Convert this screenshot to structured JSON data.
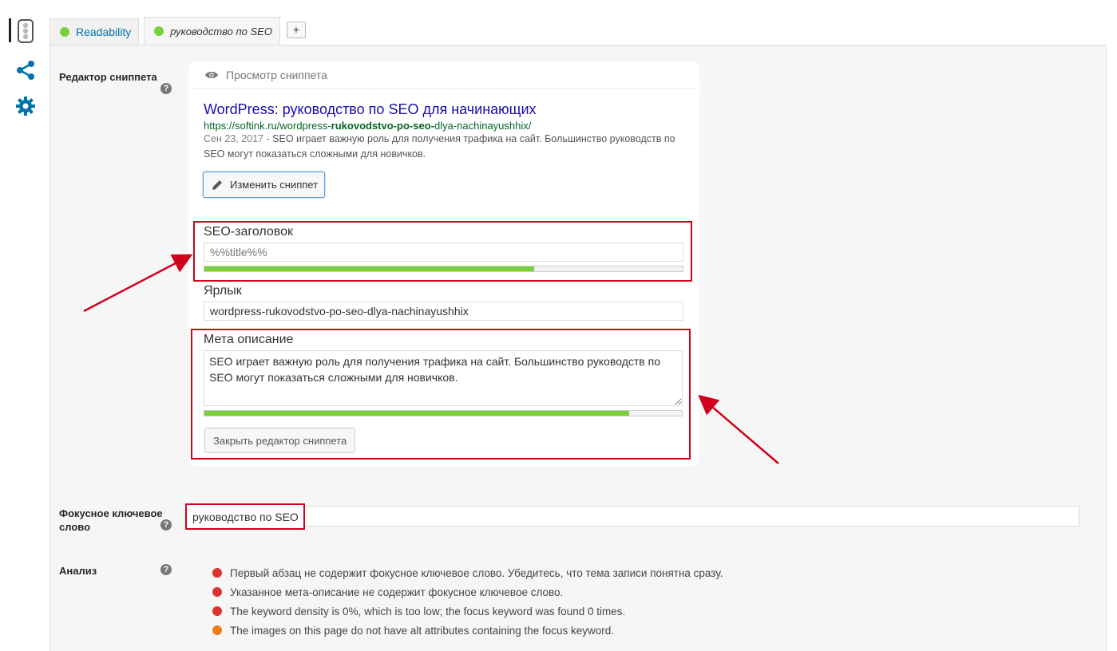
{
  "sidebar": {
    "icons": [
      "traffic-light-icon",
      "share-icon",
      "gear-icon"
    ]
  },
  "tabs": [
    {
      "label": "Readability",
      "status_color": "#7ad03a"
    },
    {
      "label": "руководство по SEO",
      "status_color": "#7ad03a"
    }
  ],
  "add_tab_label": "+",
  "snippet_editor": {
    "section_label": "Редактор сниппета",
    "preview_header": "Просмотр сниппета",
    "preview": {
      "title": "WordPress: руководство по SEO для начинающих",
      "url_prefix": "https://softink.ru/wordpress-",
      "url_bold": "rukovodstvo-po-seo-",
      "url_suffix": "dlya-nachinayushhix/",
      "date": "Сен 23, 2017 -",
      "description": "SEO играет важную роль для получения трафика на сайт. Большинство руководств по SEO могут показаться сложными для новичков."
    },
    "edit_button": "Изменить сниппет",
    "seo_title_label": "SEO-заголовок",
    "seo_title_value": "%%title%%",
    "seo_title_progress": 0.69,
    "slug_label": "Ярлык",
    "slug_value": "wordpress-rukovodstvo-po-seo-dlya-nachinayushhix",
    "meta_label": "Мета описание",
    "meta_value": "SEO играет важную роль для получения трафика на сайт. Большинство руководств по SEO могут показаться сложными для новичков.",
    "meta_progress": 0.89,
    "close_button": "Закрыть редактор сниппета"
  },
  "focus_keyword": {
    "label": "Фокусное ключевое слово",
    "value": "руководство по SEO"
  },
  "analysis": {
    "label": "Анализ",
    "items": [
      {
        "text": "Первый абзац не содержит фокусное ключевое слово. Убедитесь, что тема записи понятна сразу.",
        "color": "#dc3232"
      },
      {
        "text": "Указанное мета-описание не содержит фокусное ключевое слово.",
        "color": "#dc3232"
      },
      {
        "text": "The keyword density is 0%, which is too low; the focus keyword was found 0 times.",
        "color": "#dc3232"
      },
      {
        "text": "The images on this page do not have alt attributes containing the focus keyword.",
        "color": "#ee7c1b"
      }
    ]
  },
  "help_glyph": "?",
  "colors": {
    "accent": "#0073aa",
    "good": "#7ad03a",
    "bad": "#dc3232",
    "ok": "#ee7c1b",
    "annotation": "#d0021b"
  }
}
